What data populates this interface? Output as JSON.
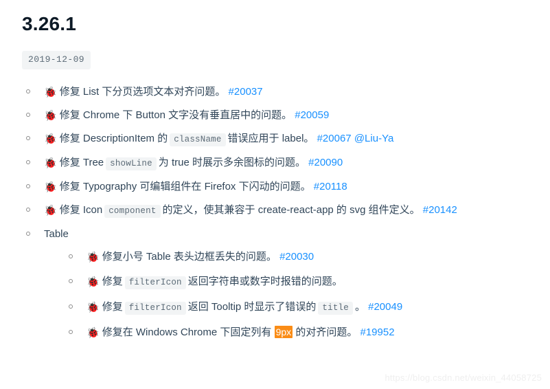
{
  "release": {
    "version": "3.26.1",
    "date": "2019-12-09"
  },
  "colors": {
    "link": "#1890ff",
    "highlight_bg": "#fa8c16",
    "code_bg": "#f2f4f5",
    "text": "#314659",
    "heading": "#0d1a26"
  },
  "icons": {
    "bug": "🐞"
  },
  "changelog": {
    "items": [
      {
        "id": "item-1",
        "bug_icon": "🐞",
        "text_before": "修复 List 下分页选项文本对齐问题。",
        "issue": "#20037"
      },
      {
        "id": "item-2",
        "bug_icon": "🐞",
        "text_before": "修复 Chrome 下 Button 文字没有垂直居中的问题。",
        "issue": "#20059"
      },
      {
        "id": "item-3",
        "bug_icon": "🐞",
        "text_before": "修复 DescriptionItem 的",
        "code": "className",
        "text_after": "错误应用于 label。",
        "issue": "#20067",
        "handle": "@Liu-Ya"
      },
      {
        "id": "item-4",
        "bug_icon": "🐞",
        "text_before": "修复 Tree",
        "code": "showLine",
        "text_after": "为 true 时展示多余图标的问题。",
        "issue": "#20090"
      },
      {
        "id": "item-5",
        "bug_icon": "🐞",
        "text_before": "修复 Typography 可编辑组件在 Firefox 下闪动的问题。",
        "issue": "#20118"
      },
      {
        "id": "item-6",
        "bug_icon": "🐞",
        "text_before": "修复 Icon",
        "code": "component",
        "text_after": "的定义，使其兼容于 create-react-app 的 svg 组件定义。",
        "issue": "#20142"
      }
    ],
    "group": {
      "label": "Table",
      "items": [
        {
          "id": "table-item-1",
          "bug_icon": "🐞",
          "text_before": "修复小号 Table 表头边框丢失的问题。",
          "issue": "#20030"
        },
        {
          "id": "table-item-2",
          "bug_icon": "🐞",
          "text_before": "修复",
          "code": "filterIcon",
          "text_after": "返回字符串或数字时报错的问题。",
          "issue": ""
        },
        {
          "id": "table-item-3",
          "bug_icon": "🐞",
          "text_before": "修复",
          "code": "filterIcon",
          "text_after": "返回 Tooltip 时显示了错误的",
          "code2": "title",
          "text_after2": "。",
          "issue": "#20049"
        },
        {
          "id": "table-item-4",
          "bug_icon": "🐞",
          "text_before": "修复在 Windows Chrome 下固定列有",
          "highlight": "9px",
          "text_after": "的对齐问题。",
          "issue": "#19952"
        }
      ]
    }
  },
  "watermark": {
    "text": "https://blog.csdn.net/weixin_44058725"
  }
}
